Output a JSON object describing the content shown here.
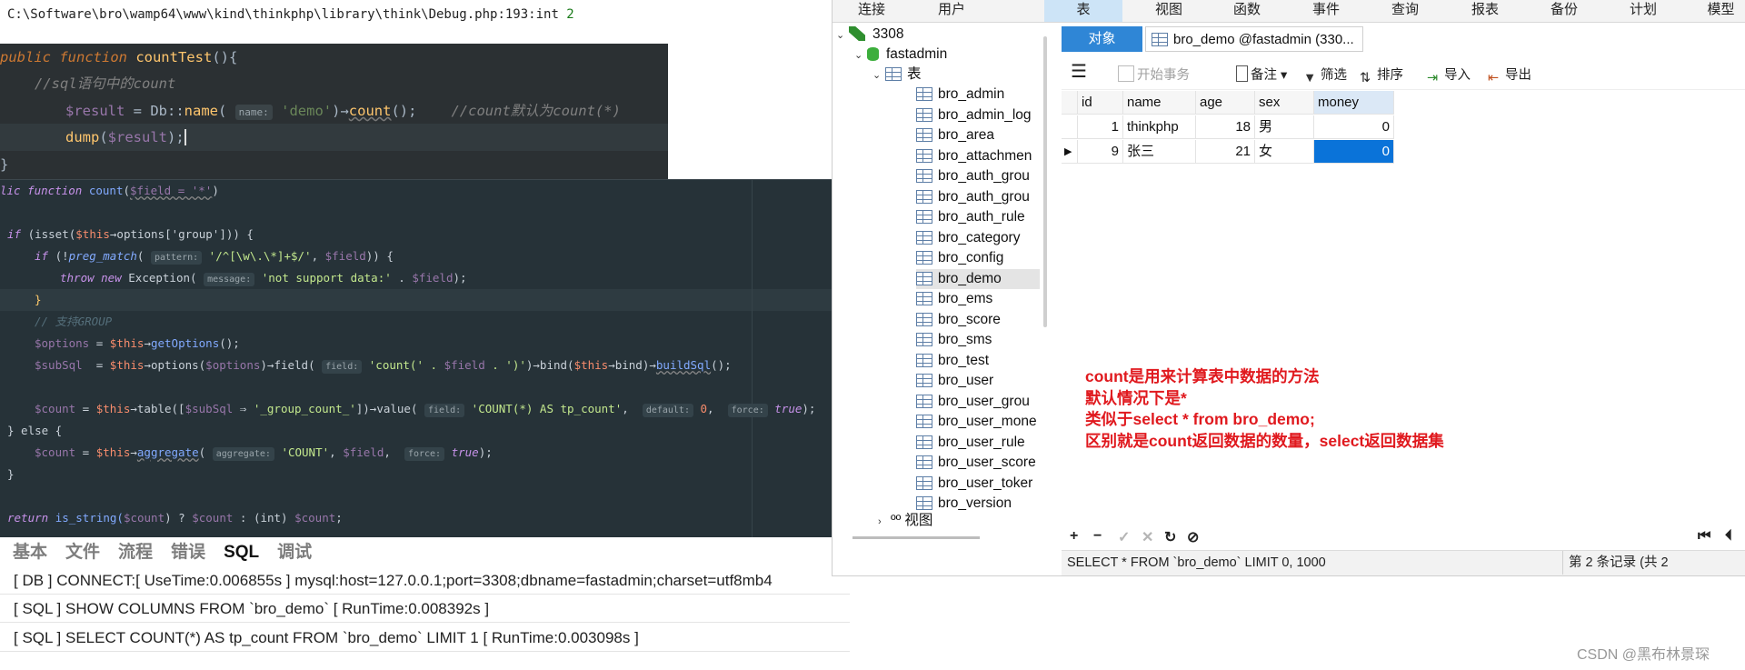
{
  "debug": {
    "path": "C:\\Software\\bro\\wamp64\\www\\kind\\thinkphp\\library\\think\\Debug.php:193:int ",
    "value": "2"
  },
  "code1": {
    "l1_kw": "public function ",
    "l1_fn": "countTest",
    "l1_rest": "(){",
    "l2_cmt": "//sql语句中的count",
    "l3_var": "$result",
    "l3_a": " = Db::",
    "l3_fn": "name",
    "l3_b": "( ",
    "l3_hint": "name:",
    "l3_str": " 'demo'",
    "l3_c": ")→",
    "l3_fn2": "count",
    "l3_d": "();",
    "l3_cmt": "//count默认为count(*)",
    "l4_fn": "dump",
    "l4_a": "(",
    "l4_var": "$result",
    "l4_b": ");",
    "l5": "}"
  },
  "code2": {
    "l1_a": "lic ",
    "l1_kw": "function ",
    "l1_fn": "count",
    "l1_b": "(",
    "l1_var": "$field = '*'",
    "l1_c": ")",
    "l3_kw": "if ",
    "l3_a": "(isset(",
    "l3_var": "$this",
    "l3_b": "→options['group'])) {",
    "l4_kw": "if ",
    "l4_a": "(!",
    "l4_fn": "preg_match",
    "l4_b": "( ",
    "l4_hint": "pattern:",
    "l4_str": " '/^[\\w\\.\\*]+$/'",
    "l4_c": ", ",
    "l4_var": "$field",
    "l4_d": ")) {",
    "l5_kw": "throw new ",
    "l5_a": "Exception( ",
    "l5_hint": "message:",
    "l5_str": " 'not support data:'",
    "l5_b": " . ",
    "l5_var": "$field",
    "l5_c": ");",
    "l6": "}",
    "l7_cmt": "// 支持GROUP",
    "l8_var": "$options",
    "l8_a": " = ",
    "l8_var2": "$this",
    "l8_b": "→",
    "l8_fn": "getOptions",
    "l8_c": "();",
    "l9_var": "$subSql",
    "l9_a": "  = ",
    "l9_var2": "$this",
    "l9_b": "→options(",
    "l9_var3": "$options",
    "l9_c": ")→field( ",
    "l9_hint": "field:",
    "l9_str": " 'count(' . ",
    "l9_var4": "$field",
    "l9_str2": " . ')'",
    "l9_d": ")→bind(",
    "l9_var5": "$this",
    "l9_e": "→bind)→",
    "l9_fn": "buildSql",
    "l9_f": "();",
    "l11_var": "$count",
    "l11_a": " = ",
    "l11_var2": "$this",
    "l11_b": "→table([",
    "l11_var3": "$subSql",
    "l11_c": " ⇒ ",
    "l11_str": "'_group_count_'",
    "l11_d": "])→value( ",
    "l11_hint": "field:",
    "l11_str2": " 'COUNT(*) AS tp_count'",
    "l11_e": ",  ",
    "l11_hint2": "default:",
    "l11_num": " 0",
    "l11_f": ",  ",
    "l11_hint3": "force:",
    "l11_kw": " true",
    "l11_g": ");",
    "l12": "} else {",
    "l13_var": "$count",
    "l13_a": " = ",
    "l13_var2": "$this",
    "l13_b": "→",
    "l13_fn": "aggregate",
    "l13_c": "( ",
    "l13_hint": "aggregate:",
    "l13_str": " 'COUNT'",
    "l13_d": ", ",
    "l13_var3": "$field",
    "l13_e": ",  ",
    "l13_hint2": "force:",
    "l13_kw": " true",
    "l13_f": ");",
    "l14": "}",
    "l16_kw": "return ",
    "l16_a": "is_string(",
    "l16_var": "$count",
    "l16_b": ") ? ",
    "l16_var2": "$count",
    "l16_c": " : (int) ",
    "l16_var3": "$count",
    "l16_d": ";"
  },
  "trace": {
    "tabs": [
      "基本",
      "文件",
      "流程",
      "错误",
      "SQL",
      "调试"
    ],
    "active": "SQL",
    "rows": [
      "[ DB ] CONNECT:[ UseTime:0.006855s ] mysql:host=127.0.0.1;port=3308;dbname=fastadmin;charset=utf8mb4",
      "[ SQL ] SHOW COLUMNS FROM `bro_demo` [ RunTime:0.008392s ]",
      "[ SQL ] SELECT COUNT(*) AS tp_count FROM `bro_demo` LIMIT 1 [ RunTime:0.003098s ]"
    ]
  },
  "navicat": {
    "menu": [
      "连接",
      "用户",
      "表",
      "视图",
      "函数",
      "事件",
      "查询",
      "报表",
      "备份",
      "计划",
      "模型"
    ],
    "menu_selected": "表",
    "tree": {
      "connection": "3308",
      "database": "fastadmin",
      "tables_label": "表",
      "tables": [
        "bro_admin",
        "bro_admin_log",
        "bro_area",
        "bro_attachmen",
        "bro_auth_grou",
        "bro_auth_grou",
        "bro_auth_rule",
        "bro_category",
        "bro_config",
        "bro_demo",
        "bro_ems",
        "bro_score",
        "bro_sms",
        "bro_test",
        "bro_user",
        "bro_user_grou",
        "bro_user_mone",
        "bro_user_rule",
        "bro_user_score",
        "bro_user_toker",
        "bro_version"
      ],
      "selected": "bro_demo",
      "views_label": "视图"
    },
    "tabs": {
      "objects": "对象",
      "table": "bro_demo @fastadmin (330..."
    },
    "toolbar": {
      "begin": "开始事务",
      "note": "备注",
      "filter": "筛选",
      "sort": "排序",
      "import": "导入",
      "export": "导出"
    },
    "grid": {
      "columns": [
        "id",
        "name",
        "age",
        "sex",
        "money"
      ],
      "rows": [
        [
          "1",
          "thinkphp",
          "18",
          "男",
          "0"
        ],
        [
          "9",
          "张三",
          "21",
          "女",
          "0"
        ]
      ]
    },
    "annotation": [
      "count是用来计算表中数据的方法",
      "默认情况下是*",
      "类似于select * from bro_demo;",
      "区别就是count返回数据的数量，select返回数据集"
    ],
    "status": {
      "sql": "SELECT * FROM `bro_demo` LIMIT 0, 1000",
      "records": "第 2 条记录 (共 2"
    }
  },
  "watermark": "CSDN @黑布林景琛",
  "colors": {
    "accent": "#2f86d6",
    "annotation": "#e0191e",
    "code_bg": "#2b3033"
  }
}
